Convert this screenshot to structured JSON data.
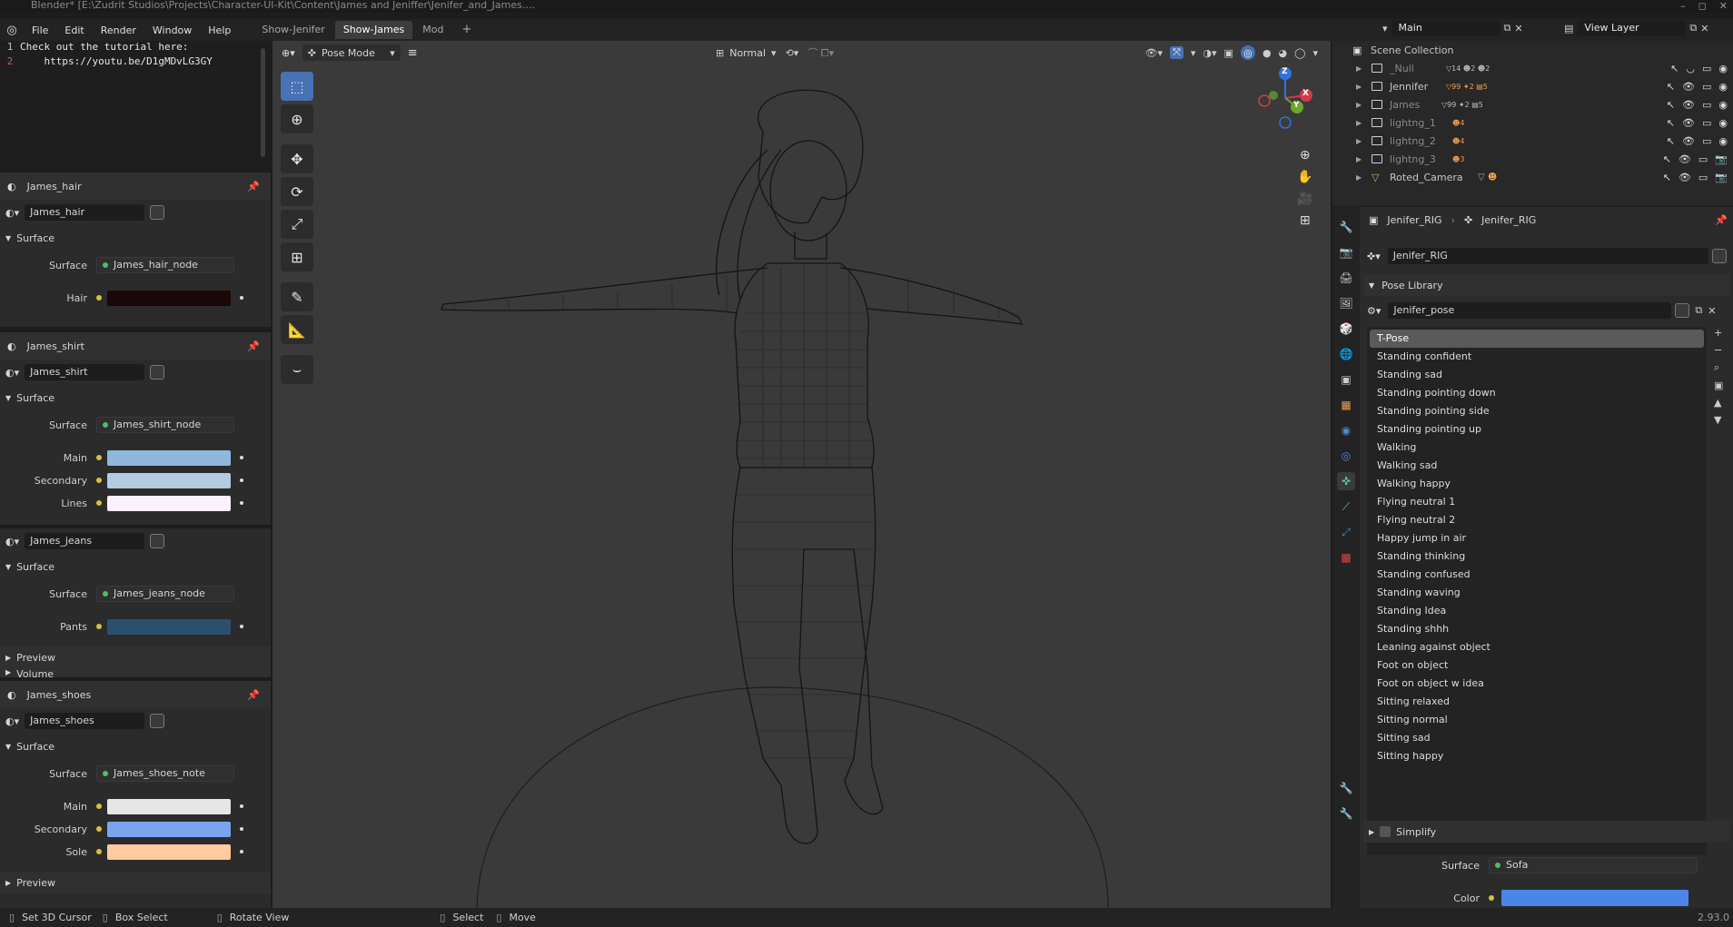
{
  "window": {
    "title": "Blender* [E:\\Zudrit Studios\\Projects\\Character-UI-Kit\\Content\\James and Jeniffer\\Jenifer_and_James....",
    "controls": [
      "–",
      "◻",
      "✕"
    ]
  },
  "menubar": {
    "items": [
      "File",
      "Edit",
      "Render",
      "Window",
      "Help"
    ],
    "workspace_tabs": [
      "Show-Jenifer",
      "Show-James",
      "Mod"
    ],
    "active_tab": "Show-James",
    "scene_name": "Main",
    "view_layer": "View Layer"
  },
  "text_editor": {
    "lines": [
      {
        "num": "1",
        "text": "Check out the tutorial here:"
      },
      {
        "num": "2",
        "text": "    https://youtu.be/D1gMDvLG3GY"
      }
    ]
  },
  "material_panels": [
    {
      "title": "James_hair",
      "material": "James_hair",
      "section": "Surface",
      "surface_label": "Surface",
      "surface_node": "James_hair_node",
      "rows": [
        {
          "label": "Hair",
          "color": "#1a0808"
        }
      ]
    },
    {
      "title": "James_shirt",
      "material": "James_shirt",
      "section": "Surface",
      "surface_label": "Surface",
      "surface_node": "James_shirt_node",
      "rows": [
        {
          "label": "Main",
          "color": "#8fb8dc"
        },
        {
          "label": "Secondary",
          "color": "#b2cbe0"
        },
        {
          "label": "Lines",
          "color": "#fcf0fc"
        }
      ]
    },
    {
      "title": "",
      "material": "James_jeans",
      "section": "Surface",
      "surface_label": "Surface",
      "surface_node": "James_jeans_node",
      "rows": [
        {
          "label": "Pants",
          "color": "#2d4f6e"
        }
      ],
      "extra_sections": [
        "Preview",
        "Volume"
      ]
    },
    {
      "title": "James_shoes",
      "material": "James_shoes",
      "section": "Surface",
      "surface_label": "Surface",
      "surface_node": "James_shoes_note",
      "rows": [
        {
          "label": "Main",
          "color": "#e6e6e6"
        },
        {
          "label": "Secondary",
          "color": "#7aa4f0"
        },
        {
          "label": "Sole",
          "color": "#ffcaa0"
        }
      ],
      "extra_sections": [
        "Preview"
      ]
    }
  ],
  "viewport": {
    "mode": "Pose Mode",
    "orientation": "Normal",
    "gizmo_axes": [
      "X",
      "Y",
      "Z"
    ]
  },
  "outliner": {
    "root": "Scene Collection",
    "rows": [
      {
        "name": "_Null",
        "dim": true,
        "counts": [
          "14",
          "2",
          "2"
        ]
      },
      {
        "name": "Jennifer",
        "dim": false,
        "counts": [
          "99",
          "2",
          "5"
        ]
      },
      {
        "name": "James",
        "dim": true,
        "counts": [
          "99",
          "2",
          "5"
        ]
      },
      {
        "name": "lightng_1",
        "dim": true,
        "counts": [
          "4"
        ]
      },
      {
        "name": "lightng_2",
        "dim": true,
        "counts": [
          "4"
        ]
      },
      {
        "name": "lightng_3",
        "dim": true,
        "counts": [
          "3"
        ]
      },
      {
        "name": "Roted_Camera",
        "dim": false,
        "counts": []
      }
    ]
  },
  "properties": {
    "breadcrumb": [
      "Jenifer_RIG",
      "Jenifer_RIG"
    ],
    "armature": "Jenifer_RIG",
    "pose_library_title": "Pose Library",
    "pose_library": "Jenifer_pose",
    "poses": [
      "T-Pose",
      "Standing confident",
      "Standing sad",
      "Standing pointing down",
      "Standing pointing side",
      "Standing pointing up",
      "Walking",
      "Walking sad",
      "Walking happy",
      "Flying neutral 1",
      "Flying neutral 2",
      "Happy jump in air",
      "Standing thinking",
      "Standing confused",
      "Standing waving",
      "Standing Idea",
      "Standing shhh",
      "Leaning against object",
      "Foot on object",
      "Foot on object w idea",
      "Sitting relaxed",
      "Sitting normal",
      "Sitting sad",
      "Sitting happy"
    ],
    "selected_pose": "T-Pose",
    "simplify_label": "Simplify",
    "surface_label": "Surface",
    "surface_value": "Sofa",
    "color_label": "Color",
    "color_value": "#4a86e8"
  },
  "statusbar": {
    "items": [
      "Set 3D Cursor",
      "Box Select",
      "Rotate View",
      "Select",
      "Move"
    ],
    "version": "2.93.0"
  }
}
